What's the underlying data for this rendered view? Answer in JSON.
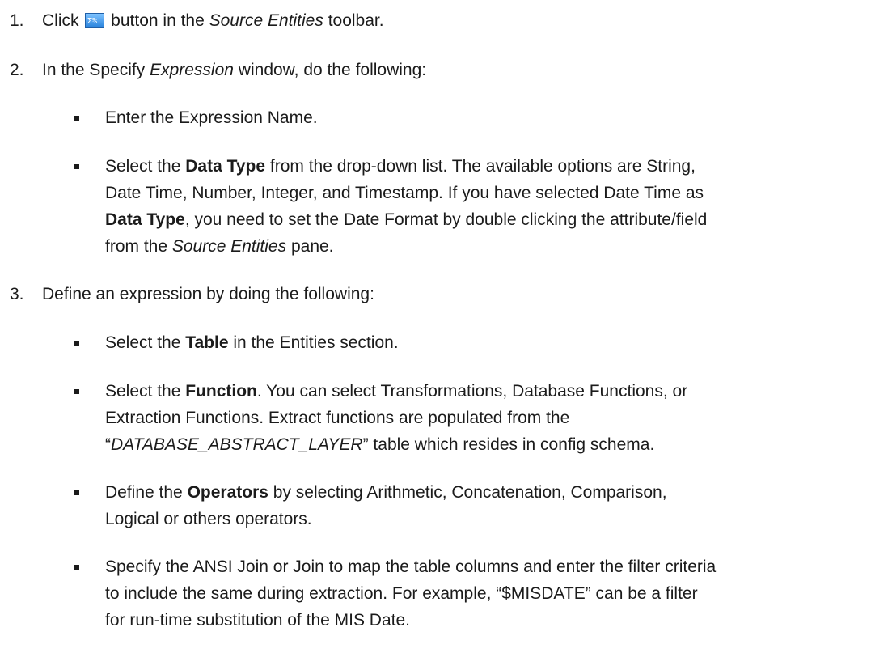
{
  "steps": {
    "s1": {
      "num": "1.",
      "pre": "Click",
      "post": " button in the ",
      "em": "Source Entities",
      "tail": " toolbar.",
      "icon": "expression-icon"
    },
    "s2": {
      "num": "2.",
      "pre": "In the Specify ",
      "em": "Expression",
      "tail": " window, do the following:"
    },
    "s2b1": "Enter the Expression Name.",
    "s2b2": {
      "l1a": "Select the ",
      "l1b": "Data Type",
      "l1c": " from the drop-down list. The available options are String,",
      "l2": "Date Time, Number, Integer, and Timestamp. If you have selected Date Time as",
      "l3b": "Data Type",
      "l3c": ", you need to set the Date Format by double clicking the attribute/field",
      "l4a": "from the ",
      "l4b": "Source Entities",
      "l4c": " pane."
    },
    "s3": {
      "num": "3.",
      "text": "Define an expression by doing the following:"
    },
    "s3b1": {
      "a": "Select the ",
      "b": "Table",
      "c": " in the Entities section."
    },
    "s3b2": {
      "l1a": "Select the ",
      "l1b": "Function",
      "l1c": ". You can select Transformations, Database Functions, or",
      "l2": "Extraction Functions. Extract functions are populated from the",
      "l3a": "“",
      "l3b": "DATABASE_ABSTRACT_LAYER",
      "l3c": "” table which resides in config schema."
    },
    "s3b3": {
      "l1a": "Define the ",
      "l1b": "Operators",
      "l1c": " by selecting Arithmetic, Concatenation, Comparison,",
      "l2": "Logical or others operators."
    },
    "s3b4": {
      "l1": "Specify the ANSI Join or Join to map the table columns and enter the filter criteria",
      "l2": "to include the same during extraction. For example, “$MISDATE” can be a filter",
      "l3": "for run-time substitution of the MIS Date."
    }
  }
}
